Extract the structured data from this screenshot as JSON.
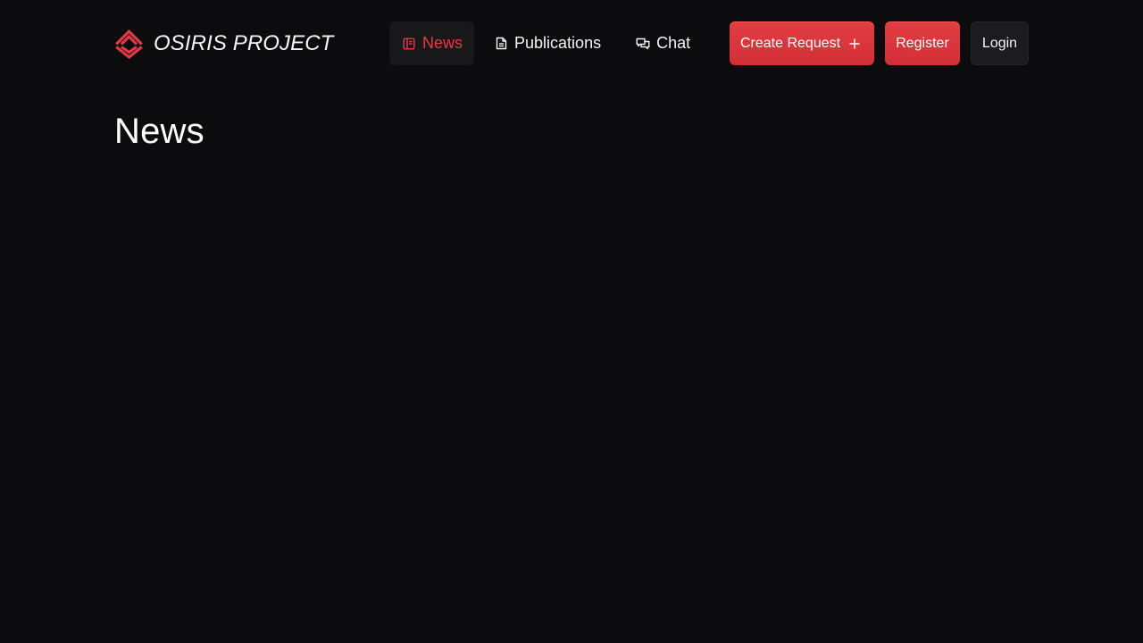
{
  "brand": {
    "name": "OSIRIS PROJECT",
    "logo_icon": "osiris-diamond-logo-icon"
  },
  "nav": {
    "items": [
      {
        "label": "News",
        "icon": "newspaper-icon",
        "active": true
      },
      {
        "label": "Publications",
        "icon": "document-icon",
        "active": false
      },
      {
        "label": "Chat",
        "icon": "chat-bubbles-icon",
        "active": false
      }
    ]
  },
  "actions": {
    "create_request": {
      "label": "Create Request",
      "icon": "plus-icon"
    },
    "register": {
      "label": "Register"
    },
    "login": {
      "label": "Login"
    }
  },
  "main": {
    "title": "News"
  },
  "colors": {
    "background": "#0c0c0e",
    "accent": "#e53944",
    "button_red": "#dc353d",
    "nav_active_bg": "#18181b",
    "login_bg": "#1b1b20",
    "text": "#f4f4f5"
  }
}
